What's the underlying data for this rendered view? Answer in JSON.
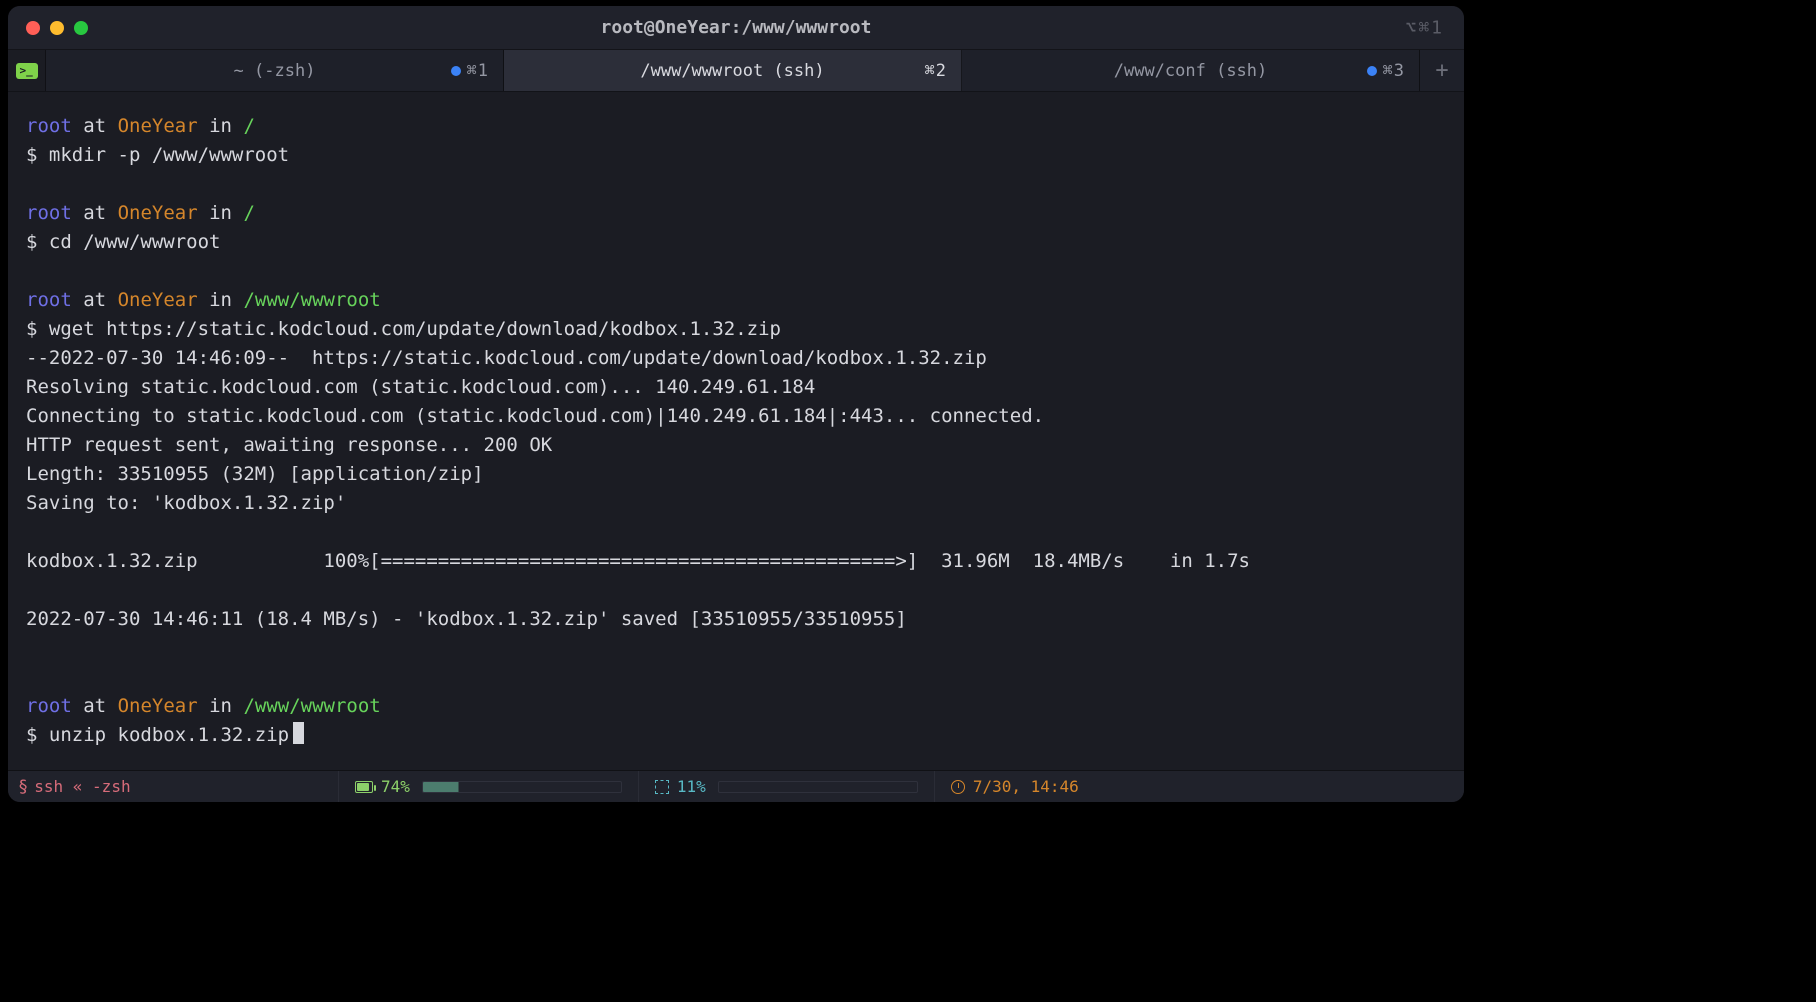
{
  "window": {
    "title": "root@OneYear:/www/wwwroot",
    "tablet_shortcut": "⌥⌘1"
  },
  "tabs": [
    {
      "label": "~ (-zsh)",
      "shortcut": "⌘1",
      "active": false,
      "has_dot": true
    },
    {
      "label": "/www/wwwroot (ssh)",
      "shortcut": "⌘2",
      "active": true,
      "has_dot": false
    },
    {
      "label": "/www/conf (ssh)",
      "shortcut": "⌘3",
      "active": false,
      "has_dot": true
    }
  ],
  "prompts": [
    {
      "user": "root",
      "at": "at",
      "host": "OneYear",
      "in": "in",
      "path": "/",
      "cmd": "mkdir -p /www/wwwroot"
    },
    {
      "user": "root",
      "at": "at",
      "host": "OneYear",
      "in": "in",
      "path": "/",
      "cmd": "cd /www/wwwroot"
    },
    {
      "user": "root",
      "at": "at",
      "host": "OneYear",
      "in": "in",
      "path": "/www/wwwroot",
      "cmd": "wget https://static.kodcloud.com/update/download/kodbox.1.32.zip"
    },
    {
      "user": "root",
      "at": "at",
      "host": "OneYear",
      "in": "in",
      "path": "/www/wwwroot",
      "cmd": "unzip kodbox.1.32.zip"
    }
  ],
  "wget_output": {
    "l1": "--2022-07-30 14:46:09--  https://static.kodcloud.com/update/download/kodbox.1.32.zip",
    "l2": "Resolving static.kodcloud.com (static.kodcloud.com)... 140.249.61.184",
    "l3": "Connecting to static.kodcloud.com (static.kodcloud.com)|140.249.61.184|:443... connected.",
    "l4": "HTTP request sent, awaiting response... 200 OK",
    "l5": "Length: 33510955 (32M) [application/zip]",
    "l6": "Saving to: 'kodbox.1.32.zip'",
    "progress": "kodbox.1.32.zip           100%[=============================================>]  31.96M  18.4MB/s    in 1.7s",
    "done": "2022-07-30 14:46:11 (18.4 MB/s) - 'kodbox.1.32.zip' saved [33510955/33510955]"
  },
  "statusbar": {
    "session": "ssh « -zsh",
    "battery": "74%",
    "cpu": "11%",
    "datetime": "7/30, 14:46"
  },
  "glyphs": {
    "dollar": "$",
    "term_icon": ">_",
    "link": "§"
  }
}
